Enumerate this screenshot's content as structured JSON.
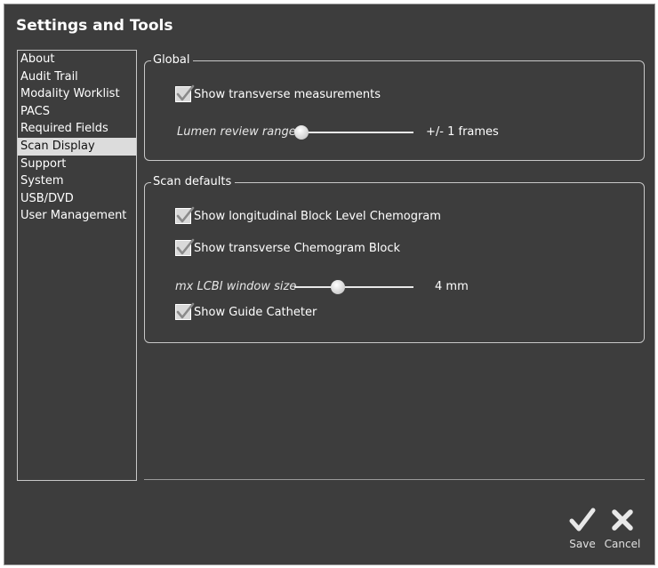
{
  "dialog": {
    "title": "Settings and Tools"
  },
  "sidebar": {
    "items": [
      {
        "label": "About"
      },
      {
        "label": "Audit Trail"
      },
      {
        "label": "Modality Worklist"
      },
      {
        "label": "PACS"
      },
      {
        "label": "Required Fields"
      },
      {
        "label": "Scan Display",
        "selected": true
      },
      {
        "label": "Support"
      },
      {
        "label": "System"
      },
      {
        "label": "USB/DVD"
      },
      {
        "label": "User Management"
      }
    ]
  },
  "global": {
    "legend": "Global",
    "show_transverse_measurements": {
      "label": "Show transverse measurements",
      "checked": true
    },
    "lumen_review_range": {
      "label": "Lumen review range",
      "value_text": "+/- 1 frames",
      "fraction": 0.0
    }
  },
  "scan_defaults": {
    "legend": "Scan defaults",
    "show_longitudinal_block": {
      "label": "Show longitudinal Block Level Chemogram",
      "checked": true
    },
    "show_transverse_block": {
      "label": "Show transverse Chemogram Block",
      "checked": true
    },
    "lcbi_window_size": {
      "label": "mx LCBI window size",
      "value_text": "4 mm",
      "fraction": 0.35
    },
    "show_guide_catheter": {
      "label": "Show Guide Catheter",
      "checked": true
    }
  },
  "actions": {
    "save_label": "Save",
    "cancel_label": "Cancel"
  },
  "colors": {
    "background": "#3d3d3d",
    "selected_item": "#dcdcdc",
    "text": "#ffffff"
  }
}
